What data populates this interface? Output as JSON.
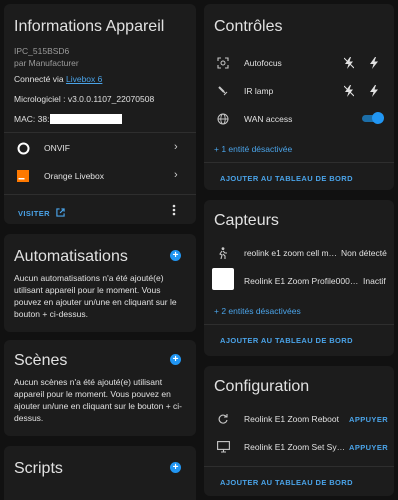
{
  "device_info": {
    "title": "Informations Appareil",
    "model": "IPC_515BSD6",
    "manufacturer": "par Manufacturer",
    "connected_prefix": "Connecté via ",
    "connected_link": "Livebox 6",
    "firmware": "Micrologiciel : v3.0.0.1107_22070508",
    "mac_label": "MAC: 38:",
    "integrations": [
      {
        "label": "ONVIF"
      },
      {
        "label": "Orange Livebox"
      }
    ],
    "visit_label": "VISITER"
  },
  "automations": {
    "title": "Automatisations",
    "text": "Aucun automatisations n'a été ajouté(e) utilisant appareil pour le moment. Vous pouvez en ajouter un/une en cliquant sur le bouton + ci-dessus."
  },
  "scenes": {
    "title": "Scènes",
    "text": "Aucun scènes n'a été ajouté(e) utilisant appareil pour le moment. Vous pouvez en ajouter un/une en cliquant sur le bouton + ci-dessus."
  },
  "scripts": {
    "title": "Scripts"
  },
  "controls": {
    "title": "Contrôles",
    "items": [
      {
        "label": "Autofocus"
      },
      {
        "label": "IR lamp"
      },
      {
        "label": "WAN access",
        "toggle_on": true
      }
    ],
    "disabled_link": "+ 1 entité désactivée",
    "add_label": "AJOUTER AU TABLEAU DE BORD"
  },
  "sensors": {
    "title": "Capteurs",
    "items": [
      {
        "label": "reolink e1 zoom cell m…",
        "value": "Non détecté"
      },
      {
        "label": "Reolink E1 Zoom Profile000…",
        "value": "Inactif"
      }
    ],
    "disabled_link": "+ 2 entités désactivées",
    "add_label": "AJOUTER AU TABLEAU DE BORD"
  },
  "configuration": {
    "title": "Configuration",
    "items": [
      {
        "label": "Reolink E1 Zoom Reboot",
        "action": "APPUYER"
      },
      {
        "label": "Reolink E1 Zoom Set Sy…",
        "action": "APPUYER"
      }
    ],
    "add_label": "AJOUTER AU TABLEAU DE BORD"
  },
  "colors": {
    "accent": "#2196f3",
    "link": "#4aa3e8",
    "card": "#1c1c1c",
    "background": "#111111"
  }
}
